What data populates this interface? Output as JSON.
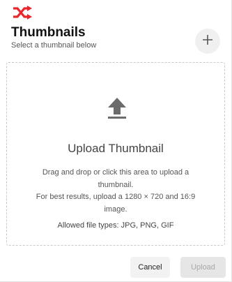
{
  "header": {
    "title": "Thumbnails",
    "subtitle": "Select a thumbnail below",
    "logo_icon": "shuffle-icon",
    "add_icon": "plus-icon"
  },
  "dropzone": {
    "icon": "upload-icon",
    "heading": "Upload Thumbnail",
    "description_line1": "Drag and drop or click this area to upload a thumbnail.",
    "description_line2": "For best results, upload a 1280 × 720 and 16:9 image.",
    "allowed_types": "Allowed file types: JPG, PNG, GIF"
  },
  "footer": {
    "cancel_label": "Cancel",
    "upload_label": "Upload",
    "upload_disabled": true
  },
  "colors": {
    "brand_red": "#e8262b",
    "icon_gray": "#6b6b6b"
  }
}
